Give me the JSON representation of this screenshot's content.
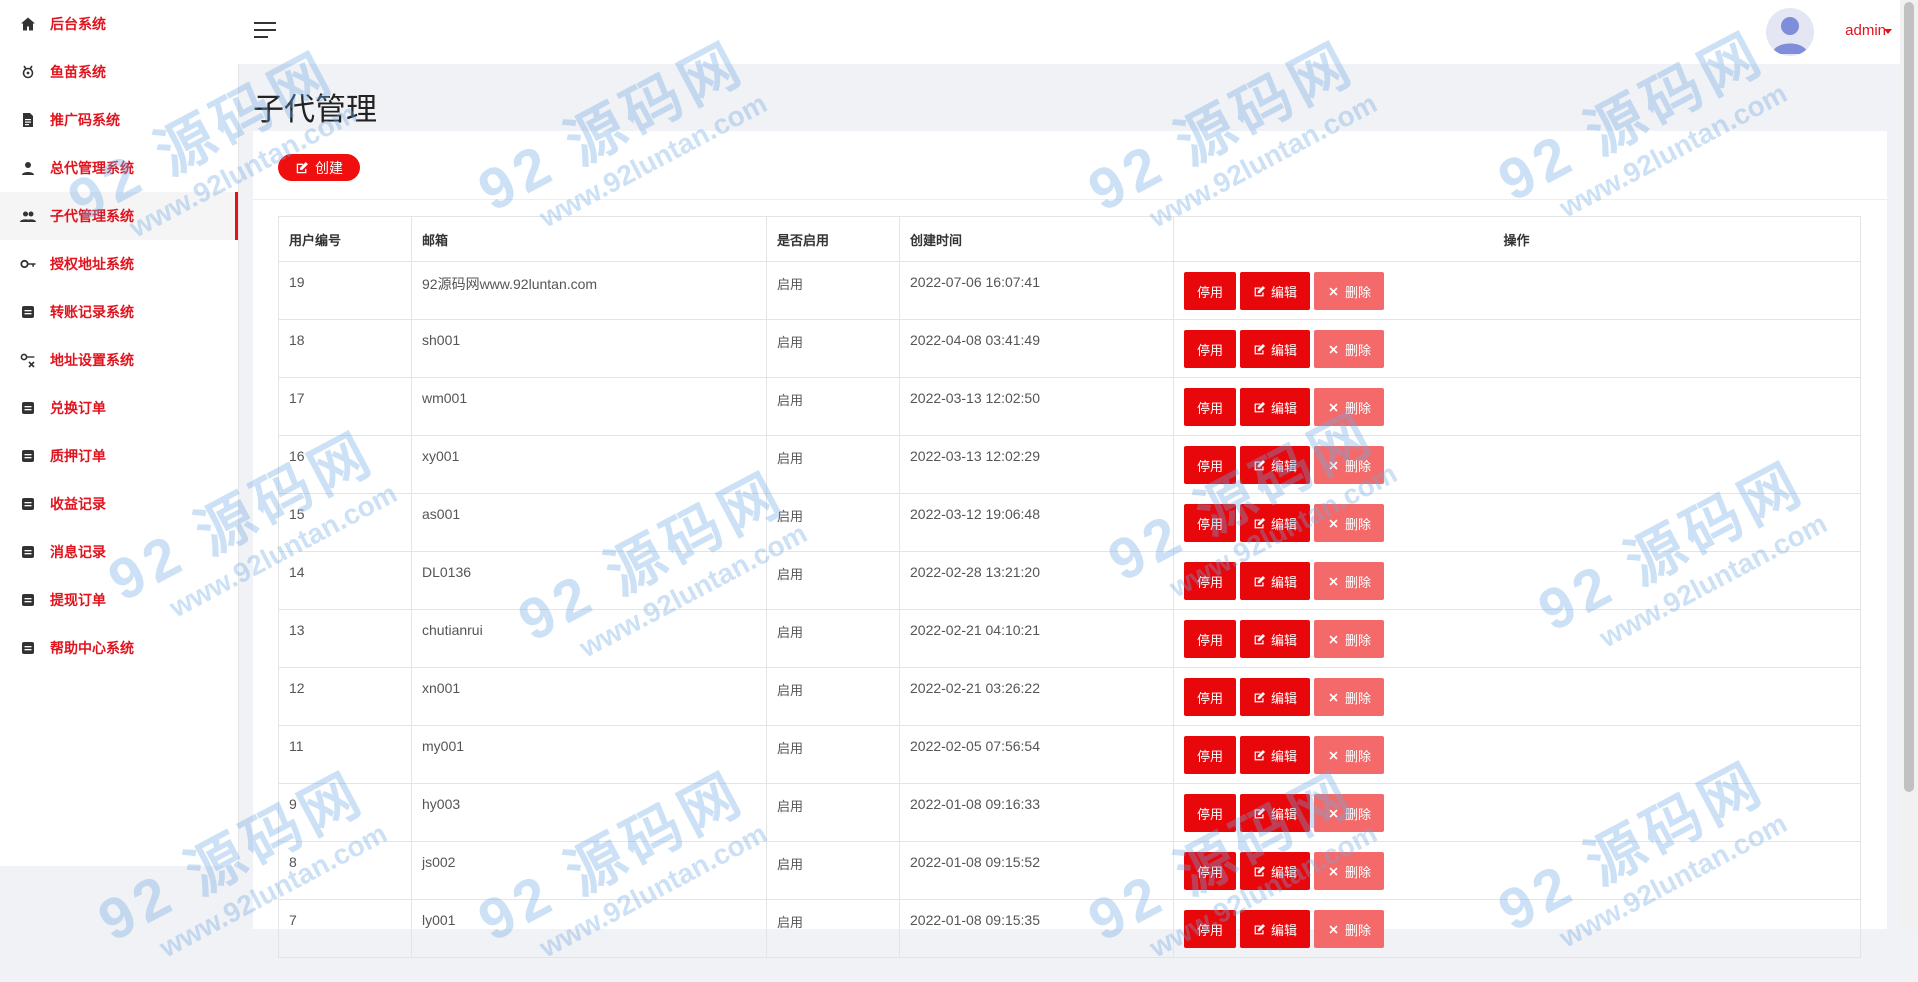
{
  "sidebar": {
    "items": [
      {
        "label": "后台系统",
        "icon": "home-icon"
      },
      {
        "label": "鱼苗系统",
        "icon": "fish-icon"
      },
      {
        "label": "推广码系统",
        "icon": "document-icon"
      },
      {
        "label": "总代管理系统",
        "icon": "person-icon"
      },
      {
        "label": "子代管理系统",
        "icon": "people-icon",
        "active": true
      },
      {
        "label": "授权地址系统",
        "icon": "key-icon"
      },
      {
        "label": "转账记录系统",
        "icon": "list-icon"
      },
      {
        "label": "地址设置系统",
        "icon": "settings-key-icon"
      },
      {
        "label": "兑换订单",
        "icon": "list-icon"
      },
      {
        "label": "质押订单",
        "icon": "list-icon"
      },
      {
        "label": "收益记录",
        "icon": "list-icon"
      },
      {
        "label": "消息记录",
        "icon": "list-icon"
      },
      {
        "label": "提现订单",
        "icon": "list-icon"
      },
      {
        "label": "帮助中心系统",
        "icon": "list-icon"
      }
    ]
  },
  "header": {
    "user_name": "admin"
  },
  "page": {
    "title": "子代管理",
    "create_label": "创建"
  },
  "table": {
    "columns": [
      "用户编号",
      "邮箱",
      "是否启用",
      "创建时间",
      "操作"
    ],
    "rows": [
      {
        "id": "19",
        "email": "92源码网www.92luntan.com",
        "state": "启用",
        "created": "2022-07-06 16:07:41"
      },
      {
        "id": "18",
        "email": "sh001",
        "state": "启用",
        "created": "2022-04-08 03:41:49"
      },
      {
        "id": "17",
        "email": "wm001",
        "state": "启用",
        "created": "2022-03-13 12:02:50"
      },
      {
        "id": "16",
        "email": "xy001",
        "state": "启用",
        "created": "2022-03-13 12:02:29"
      },
      {
        "id": "15",
        "email": "as001",
        "state": "启用",
        "created": "2022-03-12 19:06:48"
      },
      {
        "id": "14",
        "email": "DL0136",
        "state": "启用",
        "created": "2022-02-28 13:21:20"
      },
      {
        "id": "13",
        "email": "chutianrui",
        "state": "启用",
        "created": "2022-02-21 04:10:21"
      },
      {
        "id": "12",
        "email": "xn001",
        "state": "启用",
        "created": "2022-02-21 03:26:22"
      },
      {
        "id": "11",
        "email": "my001",
        "state": "启用",
        "created": "2022-02-05 07:56:54"
      },
      {
        "id": "9",
        "email": "hy003",
        "state": "启用",
        "created": "2022-01-08 09:16:33"
      },
      {
        "id": "8",
        "email": "js002",
        "state": "启用",
        "created": "2022-01-08 09:15:52"
      },
      {
        "id": "7",
        "email": "ly001",
        "state": "启用",
        "created": "2022-01-08 09:15:35"
      }
    ],
    "actions": {
      "stop": "停用",
      "edit": "编辑",
      "delete": "删除"
    }
  },
  "watermark": {
    "brand": "92 源码网",
    "url": "www.92luntan.com"
  },
  "colors": {
    "accent": "#e0141e",
    "button_primary": "#e8070b",
    "button_delete": "#f46a6a"
  }
}
